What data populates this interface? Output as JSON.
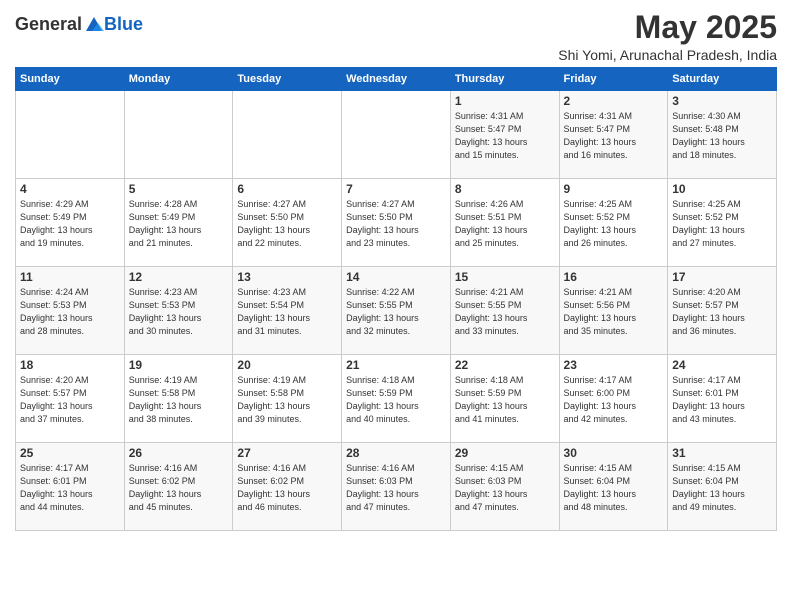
{
  "header": {
    "logo_general": "General",
    "logo_blue": "Blue",
    "month_title": "May 2025",
    "location": "Shi Yomi, Arunachal Pradesh, India"
  },
  "weekdays": [
    "Sunday",
    "Monday",
    "Tuesday",
    "Wednesday",
    "Thursday",
    "Friday",
    "Saturday"
  ],
  "weeks": [
    [
      {
        "day": "",
        "info": ""
      },
      {
        "day": "",
        "info": ""
      },
      {
        "day": "",
        "info": ""
      },
      {
        "day": "",
        "info": ""
      },
      {
        "day": "1",
        "info": "Sunrise: 4:31 AM\nSunset: 5:47 PM\nDaylight: 13 hours\nand 15 minutes."
      },
      {
        "day": "2",
        "info": "Sunrise: 4:31 AM\nSunset: 5:47 PM\nDaylight: 13 hours\nand 16 minutes."
      },
      {
        "day": "3",
        "info": "Sunrise: 4:30 AM\nSunset: 5:48 PM\nDaylight: 13 hours\nand 18 minutes."
      }
    ],
    [
      {
        "day": "4",
        "info": "Sunrise: 4:29 AM\nSunset: 5:49 PM\nDaylight: 13 hours\nand 19 minutes."
      },
      {
        "day": "5",
        "info": "Sunrise: 4:28 AM\nSunset: 5:49 PM\nDaylight: 13 hours\nand 21 minutes."
      },
      {
        "day": "6",
        "info": "Sunrise: 4:27 AM\nSunset: 5:50 PM\nDaylight: 13 hours\nand 22 minutes."
      },
      {
        "day": "7",
        "info": "Sunrise: 4:27 AM\nSunset: 5:50 PM\nDaylight: 13 hours\nand 23 minutes."
      },
      {
        "day": "8",
        "info": "Sunrise: 4:26 AM\nSunset: 5:51 PM\nDaylight: 13 hours\nand 25 minutes."
      },
      {
        "day": "9",
        "info": "Sunrise: 4:25 AM\nSunset: 5:52 PM\nDaylight: 13 hours\nand 26 minutes."
      },
      {
        "day": "10",
        "info": "Sunrise: 4:25 AM\nSunset: 5:52 PM\nDaylight: 13 hours\nand 27 minutes."
      }
    ],
    [
      {
        "day": "11",
        "info": "Sunrise: 4:24 AM\nSunset: 5:53 PM\nDaylight: 13 hours\nand 28 minutes."
      },
      {
        "day": "12",
        "info": "Sunrise: 4:23 AM\nSunset: 5:53 PM\nDaylight: 13 hours\nand 30 minutes."
      },
      {
        "day": "13",
        "info": "Sunrise: 4:23 AM\nSunset: 5:54 PM\nDaylight: 13 hours\nand 31 minutes."
      },
      {
        "day": "14",
        "info": "Sunrise: 4:22 AM\nSunset: 5:55 PM\nDaylight: 13 hours\nand 32 minutes."
      },
      {
        "day": "15",
        "info": "Sunrise: 4:21 AM\nSunset: 5:55 PM\nDaylight: 13 hours\nand 33 minutes."
      },
      {
        "day": "16",
        "info": "Sunrise: 4:21 AM\nSunset: 5:56 PM\nDaylight: 13 hours\nand 35 minutes."
      },
      {
        "day": "17",
        "info": "Sunrise: 4:20 AM\nSunset: 5:57 PM\nDaylight: 13 hours\nand 36 minutes."
      }
    ],
    [
      {
        "day": "18",
        "info": "Sunrise: 4:20 AM\nSunset: 5:57 PM\nDaylight: 13 hours\nand 37 minutes."
      },
      {
        "day": "19",
        "info": "Sunrise: 4:19 AM\nSunset: 5:58 PM\nDaylight: 13 hours\nand 38 minutes."
      },
      {
        "day": "20",
        "info": "Sunrise: 4:19 AM\nSunset: 5:58 PM\nDaylight: 13 hours\nand 39 minutes."
      },
      {
        "day": "21",
        "info": "Sunrise: 4:18 AM\nSunset: 5:59 PM\nDaylight: 13 hours\nand 40 minutes."
      },
      {
        "day": "22",
        "info": "Sunrise: 4:18 AM\nSunset: 5:59 PM\nDaylight: 13 hours\nand 41 minutes."
      },
      {
        "day": "23",
        "info": "Sunrise: 4:17 AM\nSunset: 6:00 PM\nDaylight: 13 hours\nand 42 minutes."
      },
      {
        "day": "24",
        "info": "Sunrise: 4:17 AM\nSunset: 6:01 PM\nDaylight: 13 hours\nand 43 minutes."
      }
    ],
    [
      {
        "day": "25",
        "info": "Sunrise: 4:17 AM\nSunset: 6:01 PM\nDaylight: 13 hours\nand 44 minutes."
      },
      {
        "day": "26",
        "info": "Sunrise: 4:16 AM\nSunset: 6:02 PM\nDaylight: 13 hours\nand 45 minutes."
      },
      {
        "day": "27",
        "info": "Sunrise: 4:16 AM\nSunset: 6:02 PM\nDaylight: 13 hours\nand 46 minutes."
      },
      {
        "day": "28",
        "info": "Sunrise: 4:16 AM\nSunset: 6:03 PM\nDaylight: 13 hours\nand 47 minutes."
      },
      {
        "day": "29",
        "info": "Sunrise: 4:15 AM\nSunset: 6:03 PM\nDaylight: 13 hours\nand 47 minutes."
      },
      {
        "day": "30",
        "info": "Sunrise: 4:15 AM\nSunset: 6:04 PM\nDaylight: 13 hours\nand 48 minutes."
      },
      {
        "day": "31",
        "info": "Sunrise: 4:15 AM\nSunset: 6:04 PM\nDaylight: 13 hours\nand 49 minutes."
      }
    ]
  ]
}
